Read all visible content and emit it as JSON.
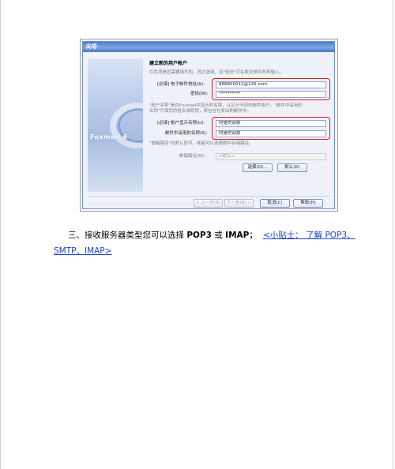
{
  "wizard": {
    "title": "向导",
    "brand": "Foxmail 6",
    "heading": "建立新的用户帐户",
    "note_required": "红色项是您需要填写的。其它选填，如\"密码\"可在收发邮件时再输入。",
    "email_label": "[必填] 电子邮件地址(A):",
    "email_value": "888800012@126.com",
    "password_label": "密码(W):",
    "password_value": "**********",
    "account_note_line1": "\"帐户名称\"是在Foxmail中显示的名称，以区分不同的邮件帐户。\"邮件中采用的",
    "account_note_line2": "名称\"可填您的姓名或昵称，将包含在发出的邮件中。",
    "account_name_label": "[必填] 帐户显示名称(U):",
    "account_name_value": "时是的刻那",
    "sender_name_label": "邮件中采用的名称(S):",
    "sender_name_value": "时是的刻那",
    "mailbox_note": "\"邮箱路径\"在默认即可，或者可以选择邮件存储路径。",
    "mailbox_path_label": "邮箱路径(M):",
    "mailbox_path_value": "<默认>",
    "select_button": "选择(O)...",
    "default_button": "默认(D)",
    "back_button": "< 上一步(B)",
    "next_button": "下一步(N) >",
    "cancel_button": "取消(C)",
    "help_button": "帮助(H)"
  },
  "body": {
    "step_text_prefix": "三、接收服务器类型您可以选择",
    "pop3": "POP3",
    "or": "或",
    "imap": "IMAP",
    "step_text_suffix": "；",
    "tip_link_line1": "<小贴士：  了解 POP3、",
    "tip_link_line2": "SMTP、IMAP>"
  }
}
